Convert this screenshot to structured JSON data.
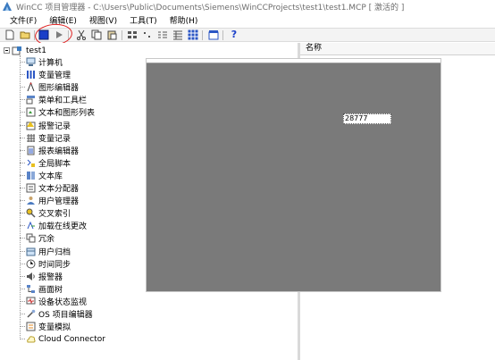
{
  "window": {
    "title": "WinCC 项目管理器 - C:\\Users\\Public\\Documents\\Siemens\\WinCCProjects\\test1\\test1.MCP [ 激活的 ]"
  },
  "menu": [
    "文件(F)",
    "编辑(E)",
    "视图(V)",
    "工具(T)",
    "帮助(H)"
  ],
  "toolbar": {
    "icons": [
      "new-icon",
      "open-icon",
      "activate-icon",
      "run-icon",
      "cut-icon",
      "copy-icon",
      "paste-icon",
      "large-icons-icon",
      "small-icons-icon",
      "list-icon",
      "details-icon",
      "grid-view-icon",
      "properties-icon",
      "help-icon"
    ],
    "help_label": "?"
  },
  "tree": {
    "root": "test1",
    "items": [
      {
        "label": "计算机",
        "icon": "computer-icon"
      },
      {
        "label": "变量管理",
        "icon": "tag-management-icon"
      },
      {
        "label": "图形编辑器",
        "icon": "graphics-designer-icon"
      },
      {
        "label": "菜单和工具栏",
        "icon": "menus-toolbars-icon"
      },
      {
        "label": "文本和图形列表",
        "icon": "text-graphic-list-icon"
      },
      {
        "label": "报警记录",
        "icon": "alarm-logging-icon"
      },
      {
        "label": "变量记录",
        "icon": "tag-logging-icon"
      },
      {
        "label": "报表编辑器",
        "icon": "report-designer-icon"
      },
      {
        "label": "全局脚本",
        "icon": "global-script-icon"
      },
      {
        "label": "文本库",
        "icon": "text-library-icon"
      },
      {
        "label": "文本分配器",
        "icon": "text-distributor-icon"
      },
      {
        "label": "用户管理器",
        "icon": "user-administrator-icon"
      },
      {
        "label": "交叉索引",
        "icon": "cross-reference-icon"
      },
      {
        "label": "加载在线更改",
        "icon": "load-online-changes-icon"
      },
      {
        "label": "冗余",
        "icon": "redundancy-icon"
      },
      {
        "label": "用户归档",
        "icon": "user-archive-icon"
      },
      {
        "label": "时间同步",
        "icon": "time-sync-icon"
      },
      {
        "label": "报警器",
        "icon": "horn-icon"
      },
      {
        "label": "画面树",
        "icon": "picture-tree-icon"
      },
      {
        "label": "设备状态监视",
        "icon": "lifebeat-monitoring-icon"
      },
      {
        "label": "OS 项目编辑器",
        "icon": "os-project-editor-icon"
      },
      {
        "label": "变量模拟",
        "icon": "tag-simulator-icon"
      },
      {
        "label": "Cloud Connector",
        "icon": "cloud-connector-icon"
      }
    ]
  },
  "details": {
    "column_name": "名称"
  },
  "runtime": {
    "io_value": "28777",
    "background_color": "#7a7a7a"
  },
  "colors": {
    "annotation": "#e02020",
    "activate": "#1a3fc9"
  }
}
